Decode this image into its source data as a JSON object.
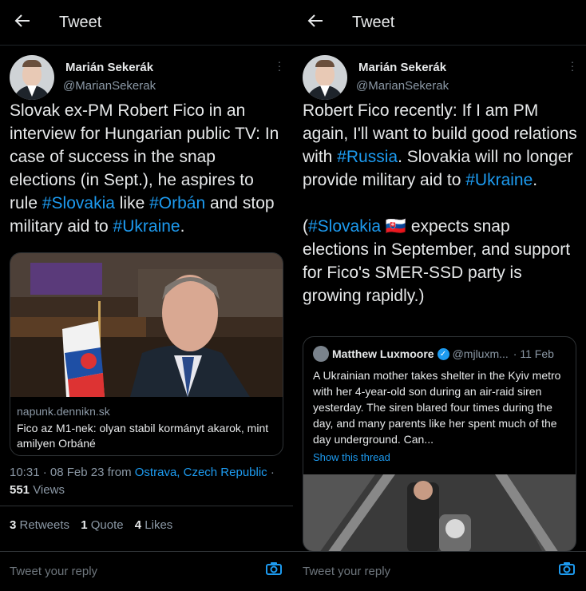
{
  "left": {
    "header_title": "Tweet",
    "author_name": "Marián Sekerák",
    "author_handle": "@MarianSekerak",
    "text_parts": [
      {
        "text": "Slovak ex-PM Robert Fico in an interview for Hungarian public TV: In case of success in the snap elections (in Sept.), he aspires to rule ",
        "tag": false
      },
      {
        "text": "#Slovakia",
        "tag": true
      },
      {
        "text": " like ",
        "tag": false
      },
      {
        "text": "#Orbán",
        "tag": true
      },
      {
        "text": " and stop military aid to ",
        "tag": false
      },
      {
        "text": "#Ukraine",
        "tag": true
      },
      {
        "text": ".",
        "tag": false
      }
    ],
    "card_domain": "napunk.dennikn.sk",
    "card_title": "Fico az M1-nek: olyan stabil kormányt akarok, mint amilyen Orbáné",
    "time": "10:31 · 08 Feb 23 from",
    "location": "Ostrava, Czech Republic",
    "location_suffix": " ·",
    "views_count": "551",
    "views_label": " Views",
    "retweets_count": "3",
    "retweets_label": " Retweets",
    "quotes_count": "1",
    "quotes_label": " Quote",
    "likes_count": "4",
    "likes_label": " Likes",
    "reply_placeholder": "Tweet your reply"
  },
  "right": {
    "header_title": "Tweet",
    "author_name": "Marián Sekerák",
    "author_handle": "@MarianSekerak",
    "para1_parts": [
      {
        "text": "Robert Fico recently: If I am PM again, I'll want to build good relations with ",
        "tag": false
      },
      {
        "text": "#Russia",
        "tag": true
      },
      {
        "text": ". Slovakia will no longer provide military aid to ",
        "tag": false
      },
      {
        "text": "#Ukraine",
        "tag": true
      },
      {
        "text": ".",
        "tag": false
      }
    ],
    "para2_parts": [
      {
        "text": "(",
        "tag": false
      },
      {
        "text": "#Slovakia",
        "tag": true
      },
      {
        "text": " 🇸🇰 expects snap elections in September, and support for Fico's SMER-SSD party is growing rapidly.)",
        "tag": false
      }
    ],
    "quote": {
      "name": "Matthew Luxmoore",
      "handle": "@mjluxm...",
      "date": "· 11 Feb",
      "text": "A Ukrainian mother takes shelter in the Kyiv metro with her 4-year-old son during an air-raid siren yesterday. The siren blared four times during the day, and many parents like her spent much of the day underground. Can...",
      "link": "Show this thread"
    },
    "reply_placeholder": "Tweet your reply"
  },
  "colors": {
    "accent": "#1d9bf0",
    "background": "#000000",
    "muted": "#8b98a5",
    "text": "#e7e9ea",
    "border": "#2f3336"
  },
  "icons": [
    "back-arrow-icon",
    "more-options-icon",
    "camera-icon",
    "verified-icon"
  ]
}
